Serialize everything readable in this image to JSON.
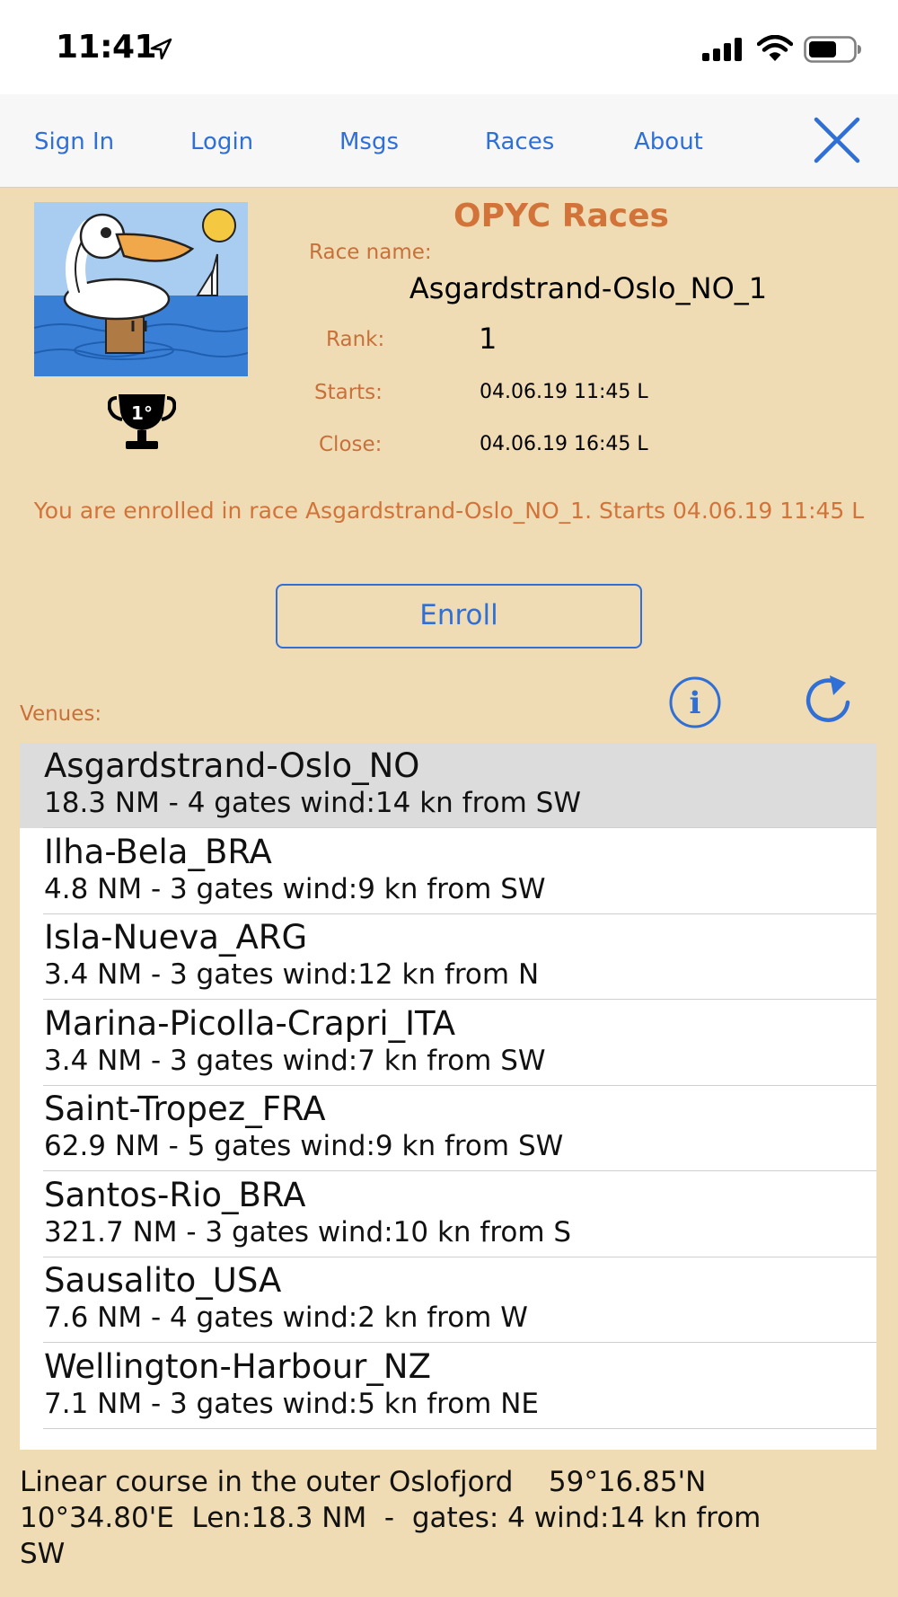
{
  "status_bar": {
    "time": "11:41"
  },
  "nav": {
    "sign_in": "Sign In",
    "login": "Login",
    "msgs": "Msgs",
    "races": "Races",
    "about": "About"
  },
  "header": {
    "title": "OPYC Races",
    "trophy_text": "1°"
  },
  "race": {
    "name_label": "Race name:",
    "name": "Asgardstrand-Oslo_NO_1",
    "rank_label": "Rank:",
    "rank": "1",
    "starts_label": "Starts:",
    "starts": "04.06.19 11:45 L",
    "close_label": "Close:",
    "close": "04.06.19 16:45 L"
  },
  "enroll_message": "You are enrolled in race Asgardstrand-Oslo_NO_1. Starts 04.06.19 11:45 L",
  "enroll_button": "Enroll",
  "venues_label": "Venues:",
  "venues": [
    {
      "name": "Asgardstrand-Oslo_NO",
      "details": "18.3 NM - 4 gates wind:14 kn from SW",
      "selected": true
    },
    {
      "name": "Ilha-Bela_BRA",
      "details": "4.8 NM - 3 gates wind:9 kn from SW",
      "selected": false
    },
    {
      "name": "Isla-Nueva_ARG",
      "details": "3.4 NM - 3 gates wind:12 kn from N",
      "selected": false
    },
    {
      "name": "Marina-Picolla-Crapri_ITA",
      "details": "3.4 NM - 3 gates wind:7 kn from SW",
      "selected": false
    },
    {
      "name": "Saint-Tropez_FRA",
      "details": "62.9 NM - 5 gates wind:9 kn from SW",
      "selected": false
    },
    {
      "name": "Santos-Rio_BRA",
      "details": "321.7 NM - 3 gates wind:10 kn from S",
      "selected": false
    },
    {
      "name": "Sausalito_USA",
      "details": "7.6 NM - 4 gates wind:2 kn from W",
      "selected": false
    },
    {
      "name": "Wellington-Harbour_NZ",
      "details": "7.1 NM - 3 gates wind:5 kn from NE",
      "selected": false
    }
  ],
  "description": "Linear course in the outer Oslofjord    59°16.85'N\n10°34.80'E  Len:18.3 NM  -  gates: 4 wind:14 kn from\nSW",
  "colors": {
    "background": "#f0dcb4",
    "accent_blue": "#2f6fd6",
    "accent_orange": "#d2733a",
    "selected_row": "#dcdcdc"
  },
  "icons": {
    "location": "location-arrow-icon",
    "signal": "cellular-signal-icon",
    "wifi": "wifi-icon",
    "battery": "battery-icon",
    "close": "close-icon",
    "info": "info-icon",
    "refresh": "refresh-icon",
    "trophy": "trophy-icon",
    "logo": "pelican-logo"
  }
}
